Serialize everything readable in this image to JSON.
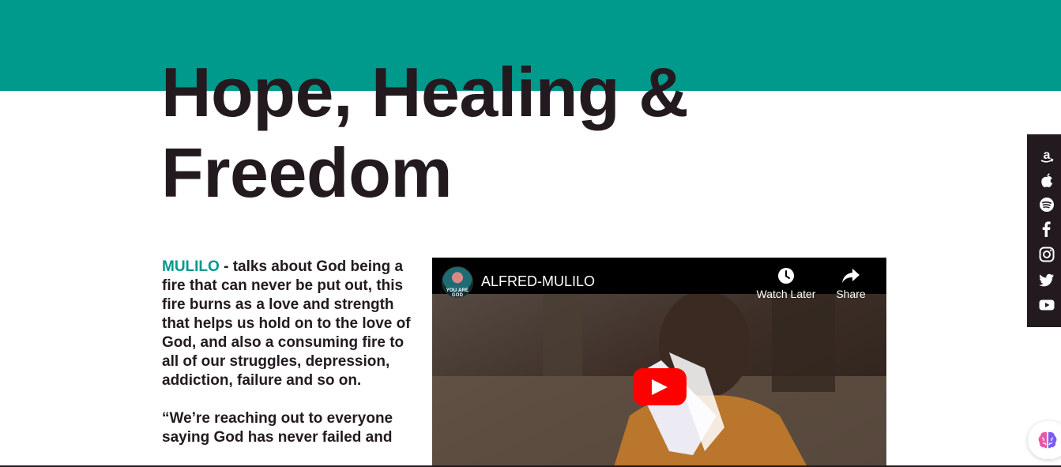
{
  "colors": {
    "accent": "#009a8c",
    "text": "#231a1f",
    "youtube_red": "#ff0000",
    "sidebar_bg": "#231a1f"
  },
  "hero": {
    "title_line1": "Hope, Healing &",
    "title_line2": "Freedom"
  },
  "article": {
    "artist": "MULILO",
    "paragraph1_rest": " - talks about God being a fire that can never be put out, this fire burns as a love and strength that helps us hold on to the love of God, and also a consuming fire to all of our struggles, depression, addiction, failure and so on.",
    "paragraph2": "“We’re reaching out to everyone saying God has never failed and"
  },
  "video": {
    "title": "ALFRED-MULILO",
    "channel_avatar_text": "YOU ARE GOD",
    "watch_later_label": "Watch Later",
    "share_label": "Share",
    "icons": {
      "watch_later": "clock-icon",
      "share": "share-arrow-icon",
      "play": "play-icon"
    }
  },
  "social": [
    {
      "name": "amazon",
      "icon": "amazon-icon"
    },
    {
      "name": "apple",
      "icon": "apple-icon"
    },
    {
      "name": "spotify",
      "icon": "spotify-icon"
    },
    {
      "name": "facebook",
      "icon": "facebook-icon"
    },
    {
      "name": "instagram",
      "icon": "instagram-icon"
    },
    {
      "name": "twitter",
      "icon": "twitter-icon"
    },
    {
      "name": "youtube",
      "icon": "youtube-icon"
    }
  ],
  "widget": {
    "icon": "brain-icon"
  }
}
